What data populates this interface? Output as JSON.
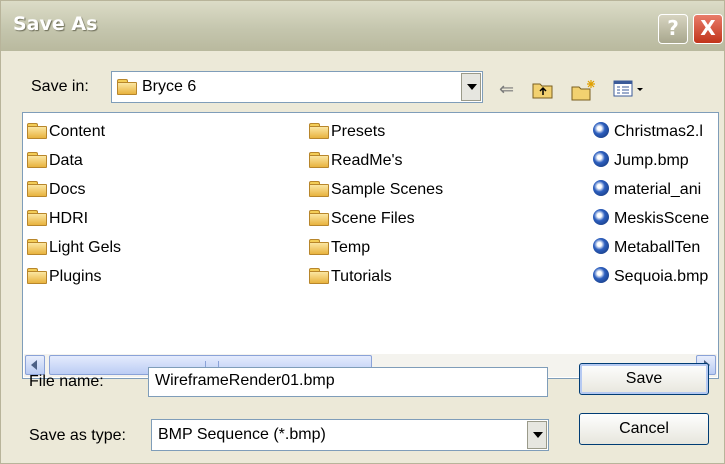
{
  "title": "Save As",
  "title_buttons": {
    "help": "?",
    "close": "X"
  },
  "save_in": {
    "label": "Save in:",
    "value": "Bryce 6"
  },
  "toolbar": {
    "back_icon": "back-arrow-icon",
    "up_icon": "up-folder-icon",
    "new_folder_icon": "new-folder-icon",
    "views_icon": "views-menu-icon"
  },
  "files": {
    "column1": [
      "Content",
      "Data",
      "Docs",
      "HDRI",
      "Light Gels",
      "Plugins"
    ],
    "column2": [
      "Presets",
      "ReadMe's",
      "Sample Scenes",
      "Scene Files",
      "Temp",
      "Tutorials"
    ],
    "column3": [
      "Christmas2.l",
      "Jump.bmp",
      "material_ani",
      "MeskisScene",
      "MetaballTen",
      "Sequoia.bmp"
    ]
  },
  "filename": {
    "label": "File name:",
    "value": "WireframeRender01.bmp"
  },
  "filetype": {
    "label": "Save as type:",
    "value": "BMP Sequence (*.bmp)"
  },
  "buttons": {
    "save": "Save",
    "cancel": "Cancel"
  }
}
